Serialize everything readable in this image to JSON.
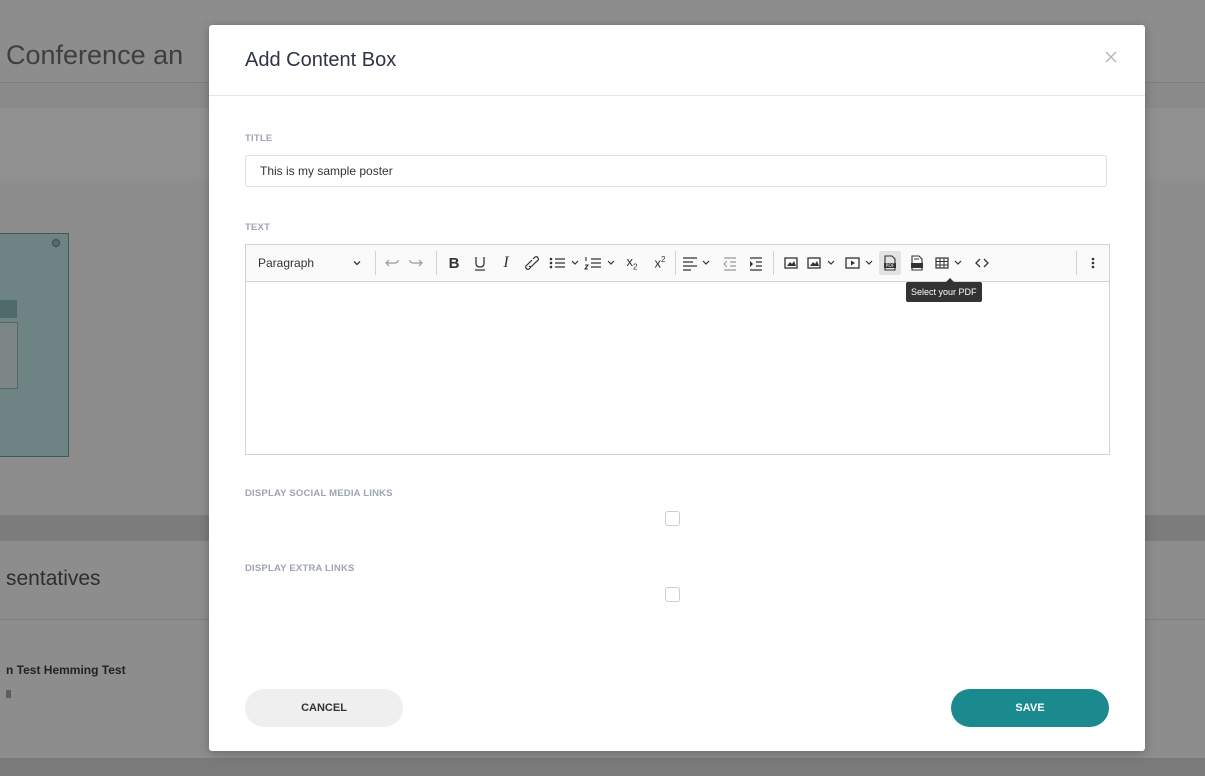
{
  "background": {
    "page_title": "Conference an",
    "section_title": "sentatives",
    "representative_name": "n Test Hemming Test"
  },
  "modal": {
    "title": "Add Content Box",
    "close_icon": "close-icon",
    "title_label": "TITLE",
    "title_value": "This is my sample poster",
    "text_label": "TEXT",
    "editor": {
      "paragraph_select": "Paragraph",
      "tooltip": "Select your PDF",
      "toolbar_icons": [
        "undo-icon",
        "redo-icon",
        "bold-icon",
        "underline-icon",
        "italic-icon",
        "link-icon",
        "bulleted-list-icon",
        "numbered-list-icon",
        "subscript-icon",
        "superscript-icon",
        "align-icon",
        "outdent-icon",
        "indent-icon",
        "image-icon",
        "image-insert-icon",
        "media-icon",
        "pdf-icon",
        "file-icon",
        "table-icon",
        "source-code-icon",
        "more-icon"
      ],
      "content": ""
    },
    "social_label": "DISPLAY SOCIAL MEDIA LINKS",
    "extra_label": "DISPLAY EXTRA LINKS",
    "cancel_label": "CANCEL",
    "save_label": "SAVE"
  },
  "colors": {
    "accent": "#1a8a8e",
    "overlay": "#8a8a8a"
  }
}
